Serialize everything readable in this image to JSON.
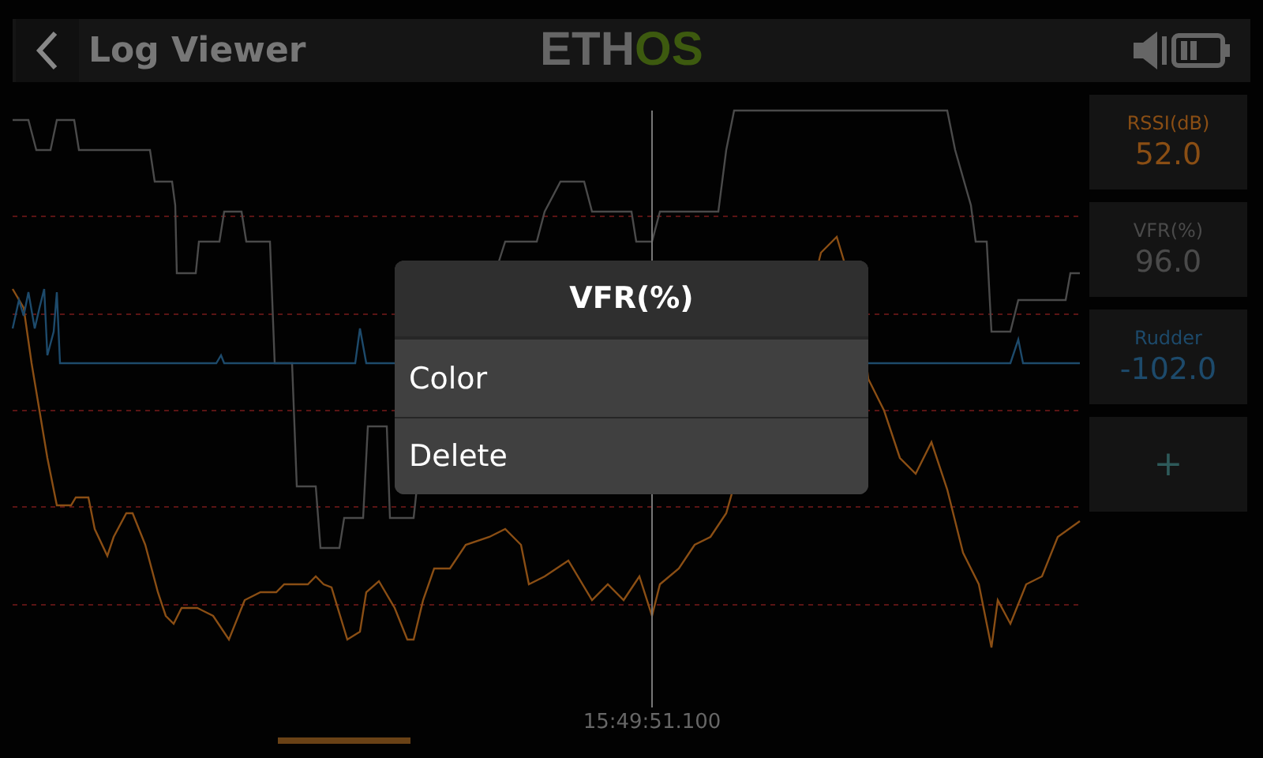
{
  "header": {
    "title": "Log Viewer",
    "logo": [
      "ETH",
      "OS"
    ]
  },
  "series": [
    {
      "name": "RSSI(dB)",
      "value": "52.0",
      "color": "#8a4e14"
    },
    {
      "name": "VFR(%)",
      "value": "96.0",
      "color": "#4a4a4a"
    },
    {
      "name": "Rudder",
      "value": "-102.0",
      "color": "#1d4a6b"
    }
  ],
  "add_button": "+",
  "cursor_time": "15:49:51.100",
  "menu": {
    "title": "VFR(%)",
    "items": [
      "Color",
      "Delete"
    ]
  }
}
